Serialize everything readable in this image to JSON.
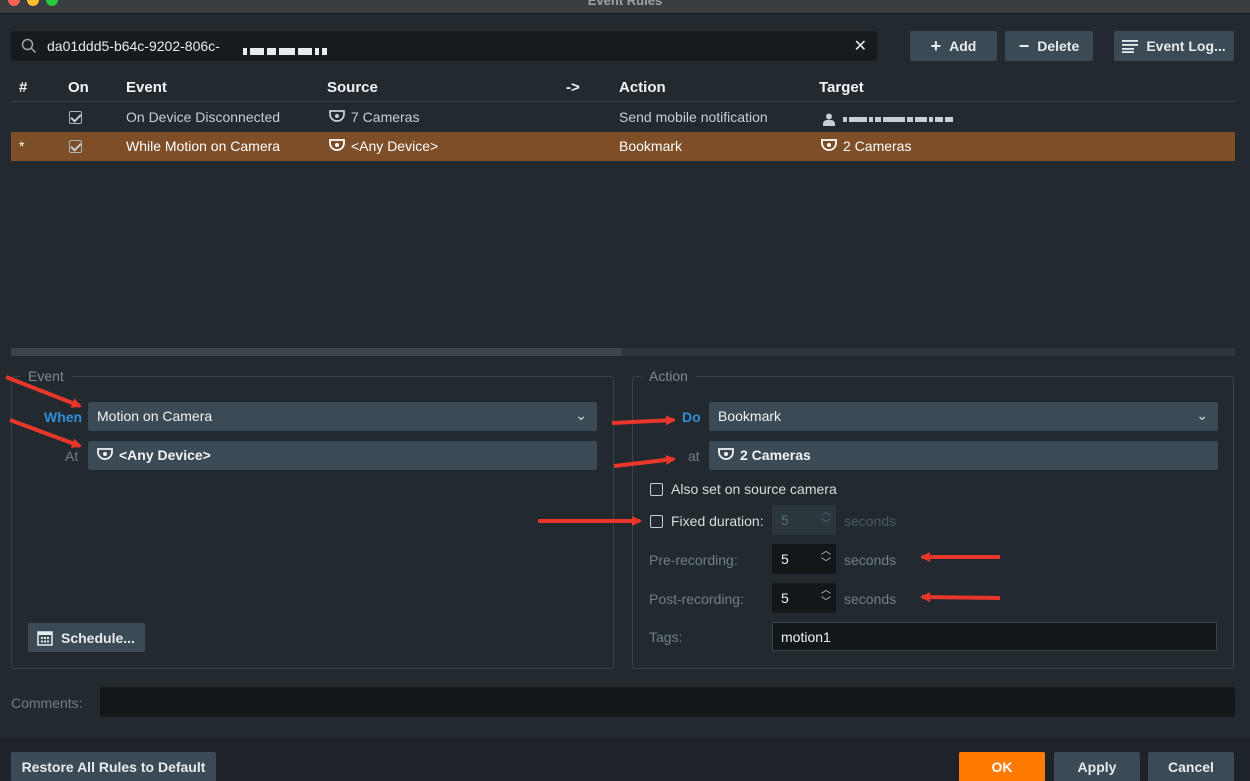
{
  "window": {
    "title": "Event Rules"
  },
  "search": {
    "value": "da01ddd5-b64c-9202-806c-"
  },
  "toolbar": {
    "add_label": "Add",
    "delete_label": "Delete",
    "eventlog_label": "Event Log..."
  },
  "table": {
    "headers": {
      "num": "#",
      "on": "On",
      "event": "Event",
      "source": "Source",
      "arrow": "->",
      "action": "Action",
      "target": "Target"
    },
    "rows": [
      {
        "num": "",
        "event": "On Device Disconnected",
        "source": "7 Cameras",
        "action": "Send mobile notification",
        "target": ""
      },
      {
        "num": "*",
        "event": "While Motion on Camera",
        "source": "<Any Device>",
        "action": "Bookmark",
        "target": "2 Cameras"
      }
    ]
  },
  "event_panel": {
    "legend": "Event",
    "when_label": "When",
    "when_value": "Motion on Camera",
    "at_label": "At",
    "at_value": "<Any Device>",
    "schedule_label": "Schedule..."
  },
  "action_panel": {
    "legend": "Action",
    "do_label": "Do",
    "do_value": "Bookmark",
    "at_label": "at",
    "at_value": "2 Cameras",
    "also_set_label": "Also set on source camera",
    "fixed_duration_label": "Fixed duration:",
    "fixed_duration_value": "5",
    "pre_label": "Pre-recording:",
    "pre_value": "5",
    "post_label": "Post-recording:",
    "post_value": "5",
    "seconds": "seconds",
    "tags_label": "Tags:",
    "tags_value": "motion1"
  },
  "comments_label": "Comments:",
  "footer": {
    "restore_label": "Restore All Rules to Default",
    "ok_label": "OK",
    "apply_label": "Apply",
    "cancel_label": "Cancel"
  },
  "colors": {
    "accent": "#2f8fd6",
    "selection": "#7d4e27",
    "ok": "#ff7a00",
    "annotation": "#e8372a"
  },
  "icons": [
    "search-icon",
    "clear-icon",
    "plus-icon",
    "minus-icon",
    "list-icon",
    "camera-icon",
    "user-icon",
    "calendar-icon",
    "chevron-down-icon"
  ]
}
